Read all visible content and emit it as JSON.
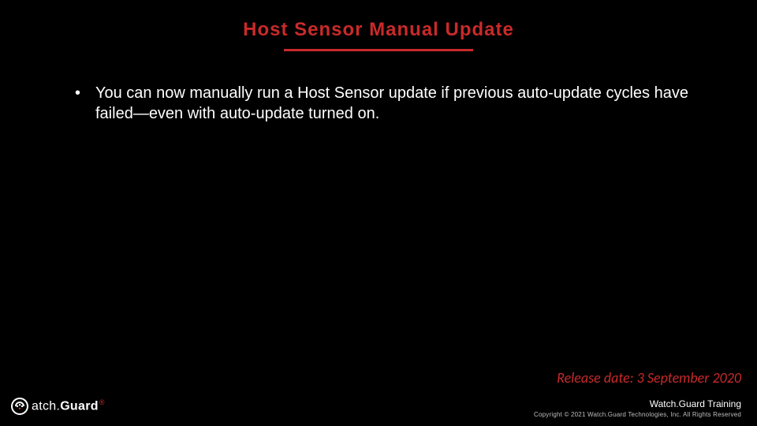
{
  "title": "Host Sensor Manual Update",
  "bullet1": "You can now manually run a Host Sensor update if previous auto-update cycles have failed—even with auto-update turned on.",
  "release": "Release date: 3 September 2020",
  "footer": {
    "training": "Watch.Guard Training",
    "copyright": "Copyright © 2021 Watch.Guard Technologies, Inc. All Rights Reserved"
  },
  "logo": {
    "part1": "atch.",
    "part2": "Guard",
    "reg": "®"
  }
}
